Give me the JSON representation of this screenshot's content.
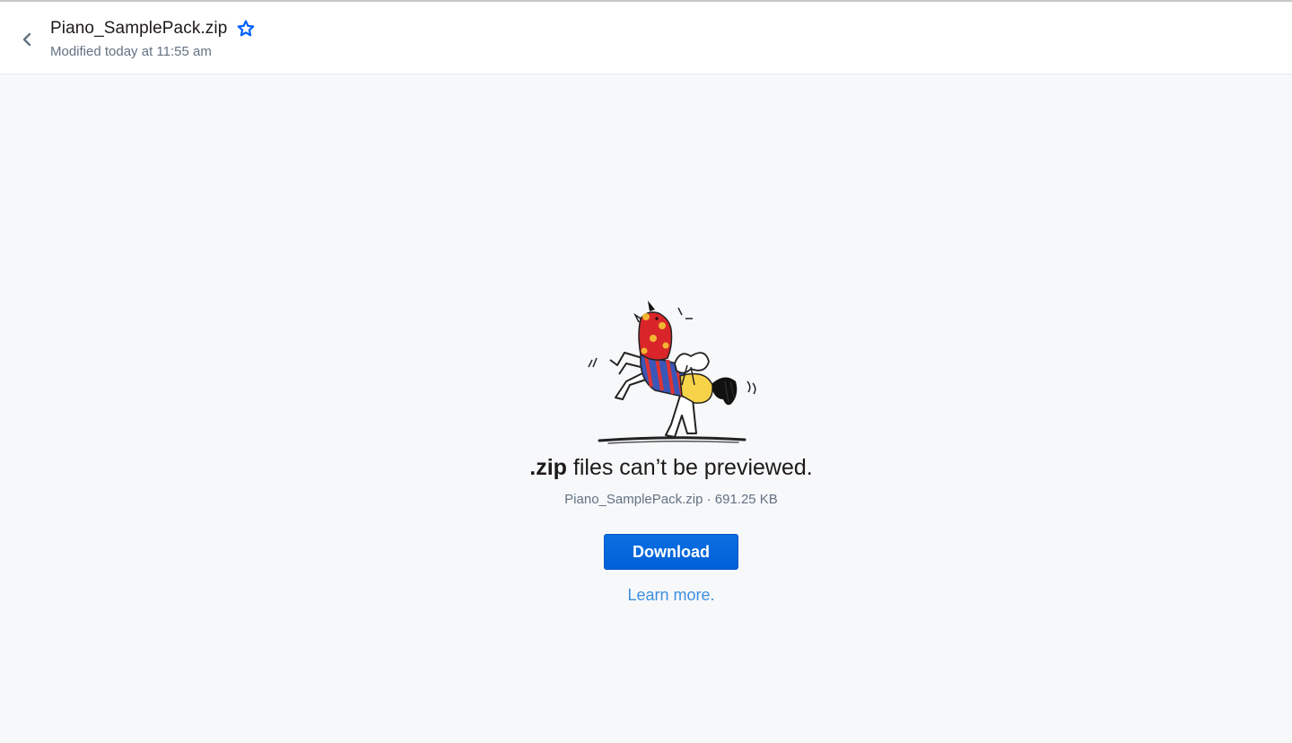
{
  "header": {
    "file_name": "Piano_SamplePack.zip",
    "modified": "Modified today at 11:55 am",
    "back_icon": "chevron-left-icon",
    "star_icon": "star-outline-icon"
  },
  "preview": {
    "message_ext": ".zip",
    "message_rest": " files can’t be previewed.",
    "file_info": "Piano_SamplePack.zip · 691.25 KB",
    "download_label": "Download",
    "learn_more_label": "Learn more.",
    "illustration": "unicorn-pinata-illustration"
  },
  "colors": {
    "accent": "#0061fe",
    "link": "#3d8fe0",
    "muted_text": "#637282",
    "background": "#f7f8fa"
  }
}
